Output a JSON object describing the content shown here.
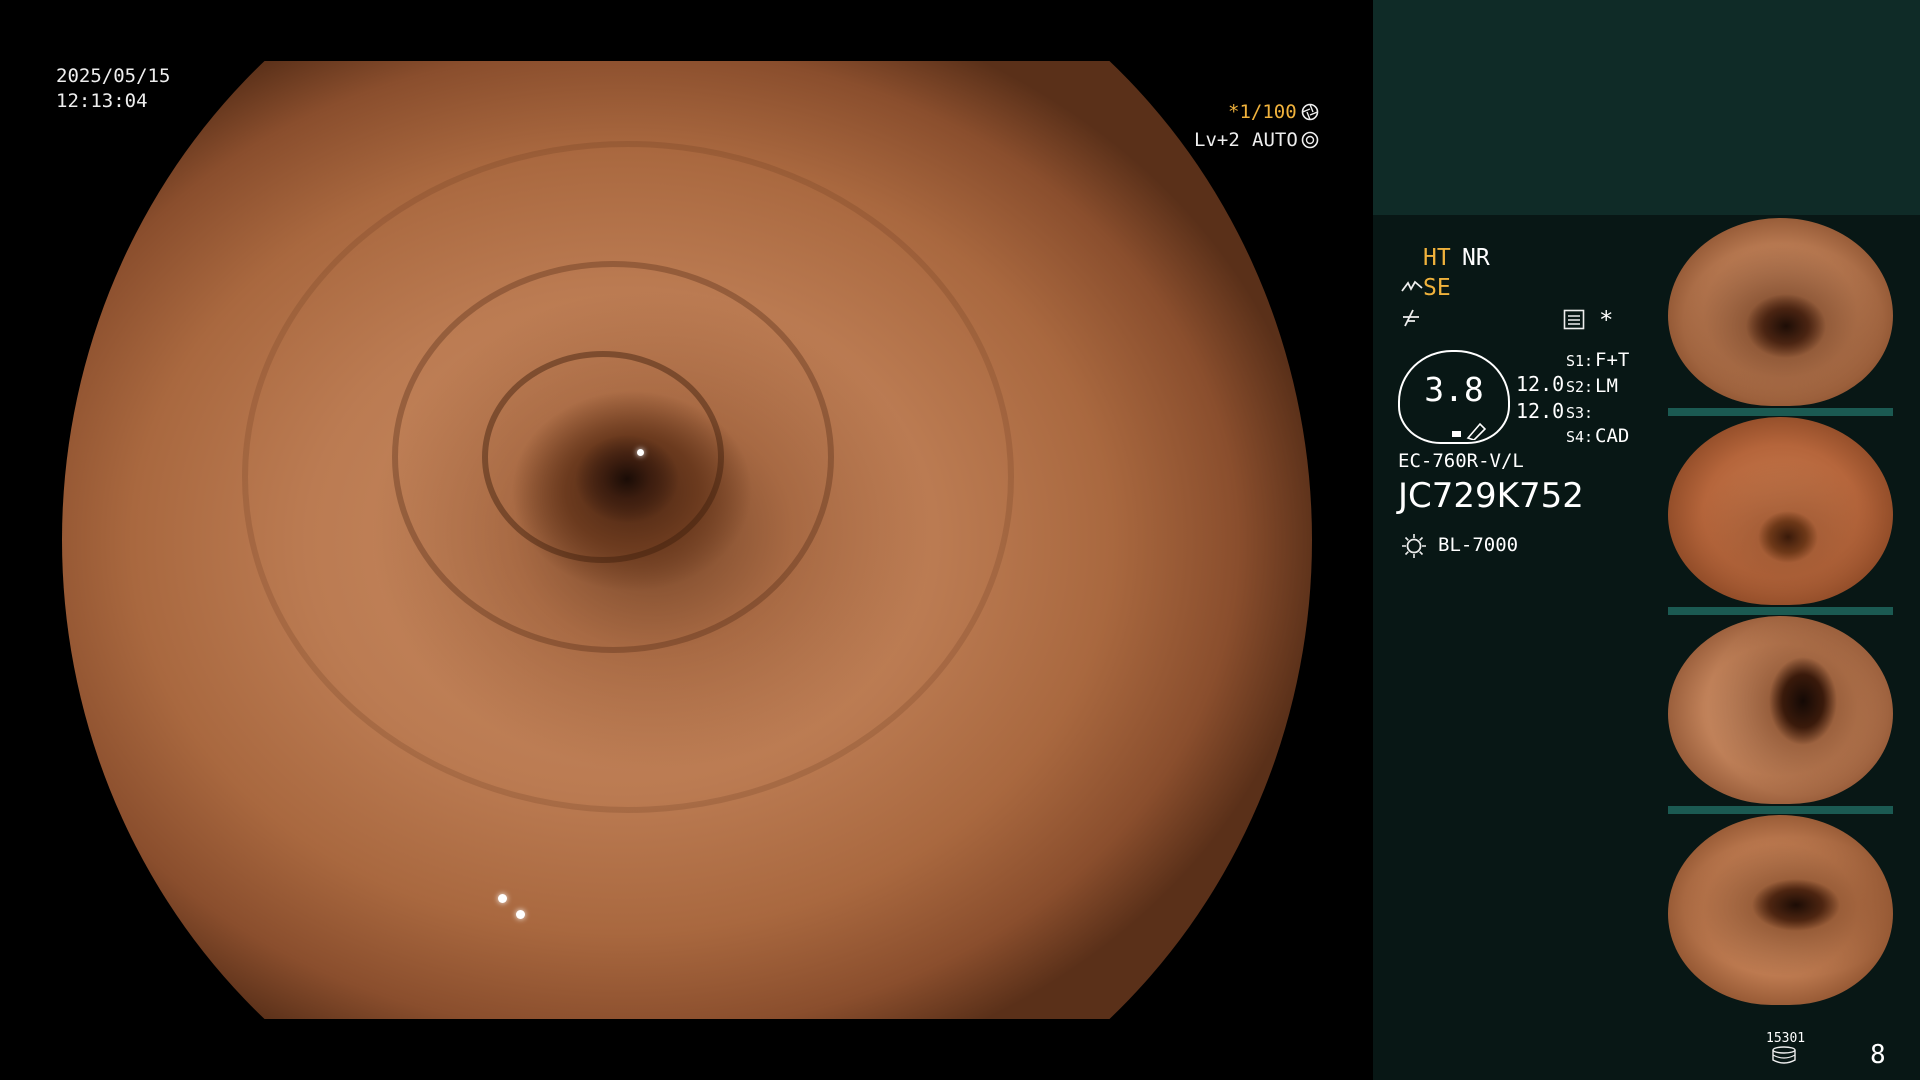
{
  "overlay": {
    "date": "2025/05/15",
    "time": "12:13:04",
    "shutter": "*1/100",
    "level": "Lv+2",
    "iris": "AUTO"
  },
  "panel": {
    "ht": "HT",
    "nr": "NR",
    "se": "SE",
    "gauge_value": "3.8",
    "val_a": "12.0",
    "val_b": "12.0",
    "s1_key": "S1:",
    "s1_val": "F+T",
    "s2_key": "S2:",
    "s2_val": "LM",
    "s3_key": "S3:",
    "s3_val": "",
    "s4_key": "S4:",
    "s4_val": "CAD",
    "scope_model": "EC-760R-V/L",
    "serial": "JC729K752",
    "light_source": "BL-7000",
    "image_count": "15301",
    "page_number": "8"
  },
  "icons": {
    "shutter_icon": "aperture-icon",
    "iris_icon": "iris-icon",
    "enhance_icon": "structure-enhance-icon",
    "color_icon": "color-mode-icon",
    "record_icon": "record-list-icon",
    "light_icon": "lamp-icon",
    "storage_icon": "disk-stack-icon"
  },
  "colors": {
    "accent_yellow": "#f0b23c",
    "panel_bg": "#081715",
    "panel_top": "#0f2b27"
  }
}
